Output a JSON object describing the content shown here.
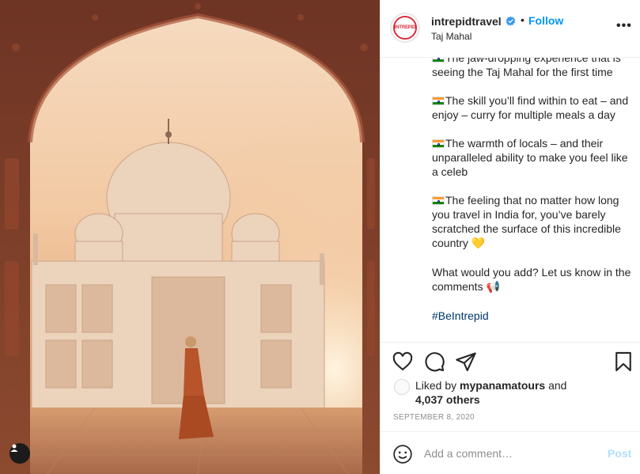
{
  "post": {
    "username": "intrepidtravel",
    "verified": true,
    "separator": "•",
    "follow_label": "Follow",
    "location": "Taj Mahal",
    "more_label": "•••",
    "avatar_text": "INTREPID",
    "photo_icon": "user-tag-icon"
  },
  "caption": {
    "line0": "The jaw-dropping experience that is seeing the Taj Mahal for the first time",
    "line1": "The skill you’ll find within to eat – and enjoy – curry for multiple meals a day",
    "line2": "The warmth of locals – and their unparalleled ability to make you feel like a celeb",
    "line3": "The feeling that no matter how long you travel in India for, you’ve barely scratched the surface of this incredible country",
    "line3_emoji": "💛",
    "question": "What would you add? Let us know in the comments",
    "question_emoji": "📢",
    "hashtag": "#BeIntrepid"
  },
  "actions": {
    "like_icon": "heart-icon",
    "comment_icon": "comment-icon",
    "share_icon": "paper-plane-icon",
    "save_icon": "bookmark-icon"
  },
  "likes": {
    "prefix": "Liked by",
    "user": "mypanamatours",
    "connector": "and",
    "others": "4,037 others"
  },
  "date": "SEPTEMBER 8, 2020",
  "comment": {
    "placeholder": "Add a comment…",
    "post_label": "Post"
  },
  "colors": {
    "link_blue": "#0095f6",
    "post_disabled": "#b2dffc",
    "hashtag": "#00376b",
    "brand_red": "#d9303e"
  }
}
